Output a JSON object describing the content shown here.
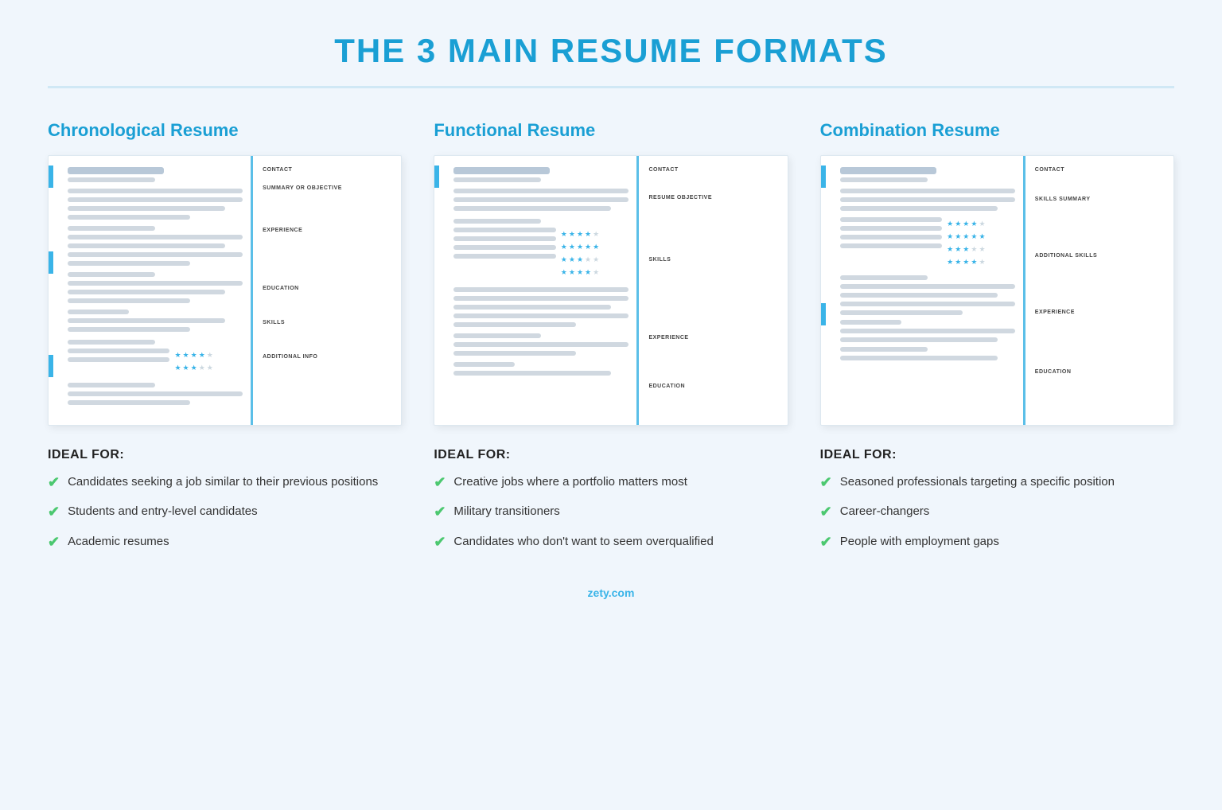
{
  "page": {
    "title": "THE 3 MAIN RESUME FORMATS",
    "footer_brand": "zety",
    "footer_domain": ".com"
  },
  "columns": [
    {
      "id": "chronological",
      "title": "Chronological Resume",
      "resume_sections": [
        "CONTACT",
        "SUMMARY OR OBJECTIVE",
        "EXPERIENCE",
        "EDUCATION",
        "SKILLS",
        "ADDITIONAL INFO"
      ],
      "ideal_for_title": "IDEAL FOR:",
      "ideal_items": [
        "Candidates seeking a job similar to their previous positions",
        "Students and entry-level candidates",
        "Academic resumes"
      ]
    },
    {
      "id": "functional",
      "title": "Functional Resume",
      "resume_sections": [
        "CONTACT",
        "RESUME OBJECTIVE",
        "SKILLS",
        "EXPERIENCE",
        "EDUCATION"
      ],
      "ideal_for_title": "IDEAL FOR:",
      "ideal_items": [
        "Creative jobs where a portfolio matters most",
        "Military transitioners",
        "Candidates who don't want to seem overqualified"
      ]
    },
    {
      "id": "combination",
      "title": "Combination Resume",
      "resume_sections": [
        "CONTACT",
        "SKILLS SUMMARY",
        "ADDITIONAL SKILLS",
        "EXPERIENCE",
        "EDUCATION"
      ],
      "ideal_for_title": "IDEAL FOR:",
      "ideal_items": [
        "Seasoned professionals targeting a specific position",
        "Career-changers",
        "People with employment gaps"
      ]
    }
  ]
}
